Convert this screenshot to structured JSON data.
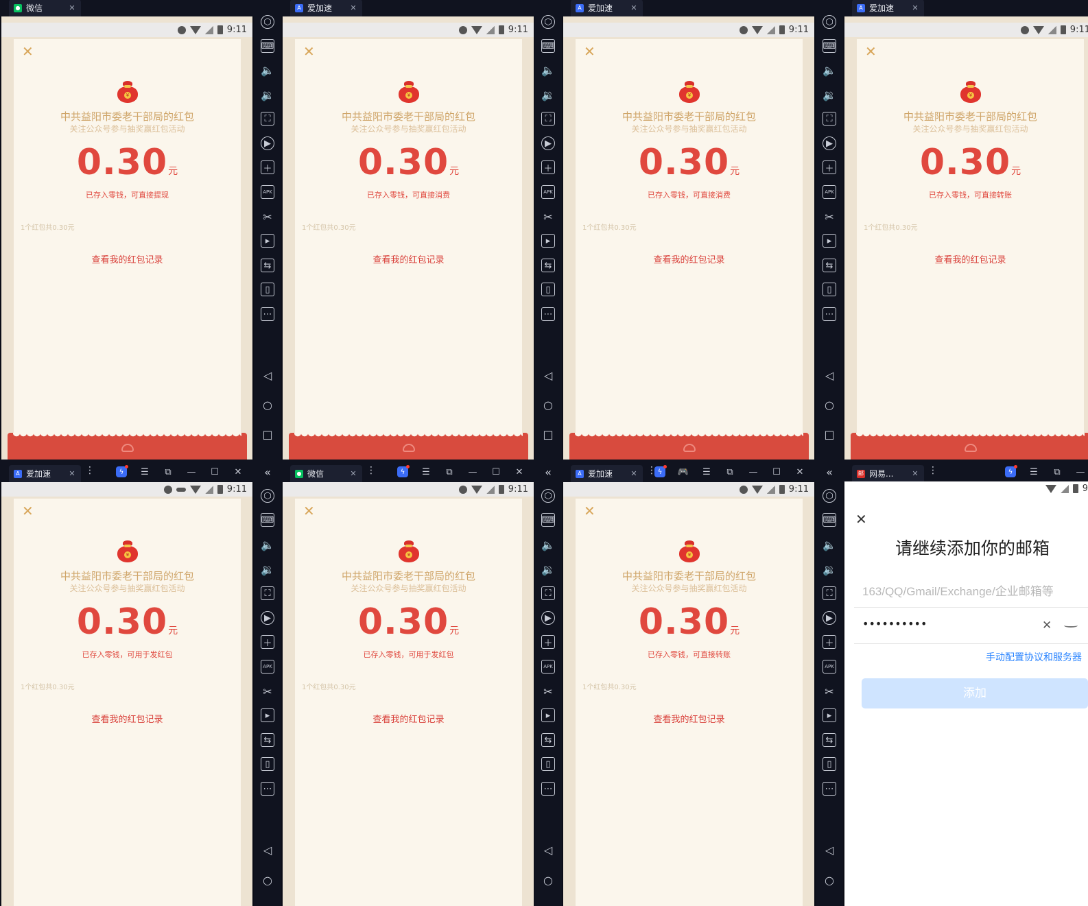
{
  "panes": [
    {
      "tab": "微信",
      "tab_icon": "wechat-icon",
      "sender": "中共益阳市委老干部局的红包",
      "subtitle": "关注公众号参与抽奖赢红包活动",
      "amount": "0.30",
      "unit": "元",
      "note": "已存入零钱，可直接提现",
      "count": "1个红包共0.30元",
      "record": "查看我的红包记录",
      "time": "9:11"
    },
    {
      "tab": "爱加速",
      "tab_icon": "aijiasu-icon",
      "sender": "中共益阳市委老干部局的红包",
      "subtitle": "关注公众号参与抽奖赢红包活动",
      "amount": "0.30",
      "unit": "元",
      "note": "已存入零钱，可直接消费",
      "count": "1个红包共0.30元",
      "record": "查看我的红包记录",
      "time": "9:11"
    },
    {
      "tab": "爱加速",
      "tab_icon": "aijiasu-icon",
      "sender": "中共益阳市委老干部局的红包",
      "subtitle": "关注公众号参与抽奖赢红包活动",
      "amount": "0.30",
      "unit": "元",
      "note": "已存入零钱，可直接消费",
      "count": "1个红包共0.30元",
      "record": "查看我的红包记录",
      "time": "9:11"
    },
    {
      "tab": "爱加速",
      "tab_icon": "aijiasu-icon",
      "sender": "中共益阳市委老干部局的红包",
      "subtitle": "关注公众号参与抽奖赢红包活动",
      "amount": "0.30",
      "unit": "元",
      "note": "已存入零钱，可直接转账",
      "count": "1个红包共0.30元",
      "record": "查看我的红包记录",
      "time": "9:11"
    },
    {
      "tab": "爱加速",
      "tab_icon": "aijiasu-icon",
      "sender": "中共益阳市委老干部局的红包",
      "subtitle": "关注公众号参与抽奖赢红包活动",
      "amount": "0.30",
      "unit": "元",
      "note": "已存入零钱，可用于发红包",
      "count": "1个红包共0.30元",
      "record": "查看我的红包记录",
      "time": "9:11"
    },
    {
      "tab": "微信",
      "tab_icon": "wechat-icon",
      "sender": "中共益阳市委老干部局的红包",
      "subtitle": "关注公众号参与抽奖赢红包活动",
      "amount": "0.30",
      "unit": "元",
      "note": "已存入零钱，可用于发红包",
      "count": "1个红包共0.30元",
      "record": "查看我的红包记录",
      "time": "9:11"
    },
    {
      "tab": "爱加速",
      "tab_icon": "aijiasu-icon",
      "sender": "中共益阳市委老干部局的红包",
      "subtitle": "关注公众号参与抽奖赢红包活动",
      "amount": "0.30",
      "unit": "元",
      "note": "已存入零钱，可直接转账",
      "count": "1个红包共0.30元",
      "record": "查看我的红包记录",
      "time": "9:11"
    }
  ],
  "email_pane": {
    "tab": "网易...",
    "tab_icon": "netease-mail-icon",
    "time": "9",
    "heading": "请继续添加你的邮箱",
    "email_placeholder": "163/QQ/Gmail/Exchange/企业邮箱等",
    "password_value": "••••••••••",
    "manual_link": "手动配置协议和服务器",
    "add_button": "添加"
  },
  "sidebar_icons": [
    "settings-hex-icon",
    "keyboard-icon",
    "volume-up-icon",
    "volume-down-icon",
    "screenshot-icon",
    "record-icon",
    "multi-window-icon",
    "apk-install-icon",
    "scissors-icon",
    "video-icon",
    "sync-icon",
    "shake-icon",
    "more-icon",
    "back-nav-icon",
    "home-nav-icon",
    "recents-nav-icon"
  ],
  "colors": {
    "red": "#e0483e",
    "gold": "#cfa569",
    "bg_cream": "#fbf6ec",
    "link_blue": "#2a84ff",
    "add_button": "#cfe4ff"
  }
}
